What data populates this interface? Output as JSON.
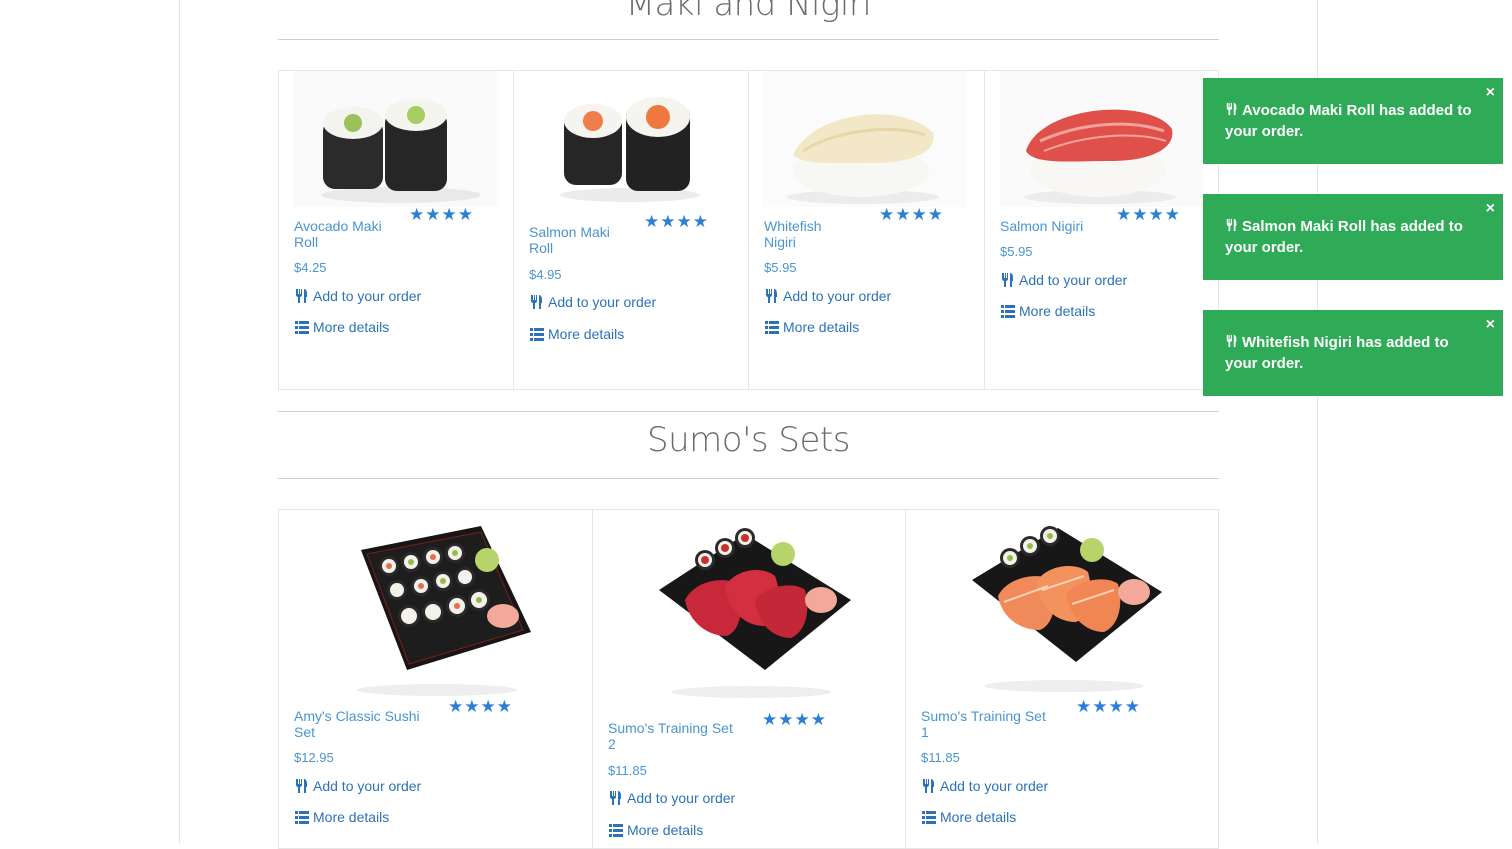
{
  "sections": [
    {
      "title": "Maki and Nigiri"
    },
    {
      "title": "Sumo's Sets"
    }
  ],
  "colors": {
    "accent": "#2d7fd1",
    "toast_bg": "#2faa56"
  },
  "maki_items": [
    {
      "name": "Avocado Maki Roll",
      "price": "$4.25",
      "rating": 4,
      "add": "Add to your order",
      "details": "More details"
    },
    {
      "name": "Salmon Maki Roll",
      "price": "$4.95",
      "rating": 4,
      "add": "Add to your order",
      "details": "More details"
    },
    {
      "name": "Whitefish Nigiri",
      "price": "$5.95",
      "rating": 4,
      "add": "Add to your order",
      "details": "More details"
    },
    {
      "name": "Salmon Nigiri",
      "price": "$5.95",
      "rating": 4,
      "add": "Add to your order",
      "details": "More details"
    }
  ],
  "set_items": [
    {
      "name": "Amy's Classic Sushi Set",
      "price": "$12.95",
      "rating": 4,
      "add": "Add to your order",
      "details": "More details"
    },
    {
      "name": "Sumo's Training Set 2",
      "price": "$11.85",
      "rating": 4,
      "add": "Add to your order",
      "details": "More details"
    },
    {
      "name": "Sumo's Training Set 1",
      "price": "$11.85",
      "rating": 4,
      "add": "Add to your order",
      "details": "More details"
    }
  ],
  "stars_text": "★★★★",
  "toasts": [
    {
      "text": "Avocado Maki Roll has added to your order.",
      "close": "×"
    },
    {
      "text": "Salmon Maki Roll has added to your order.",
      "close": "×"
    },
    {
      "text": "Whitefish Nigiri has added to your order.",
      "close": "×"
    }
  ],
  "icons": {
    "order": "cutlery-icon",
    "details": "list-icon",
    "close": "close-icon"
  }
}
